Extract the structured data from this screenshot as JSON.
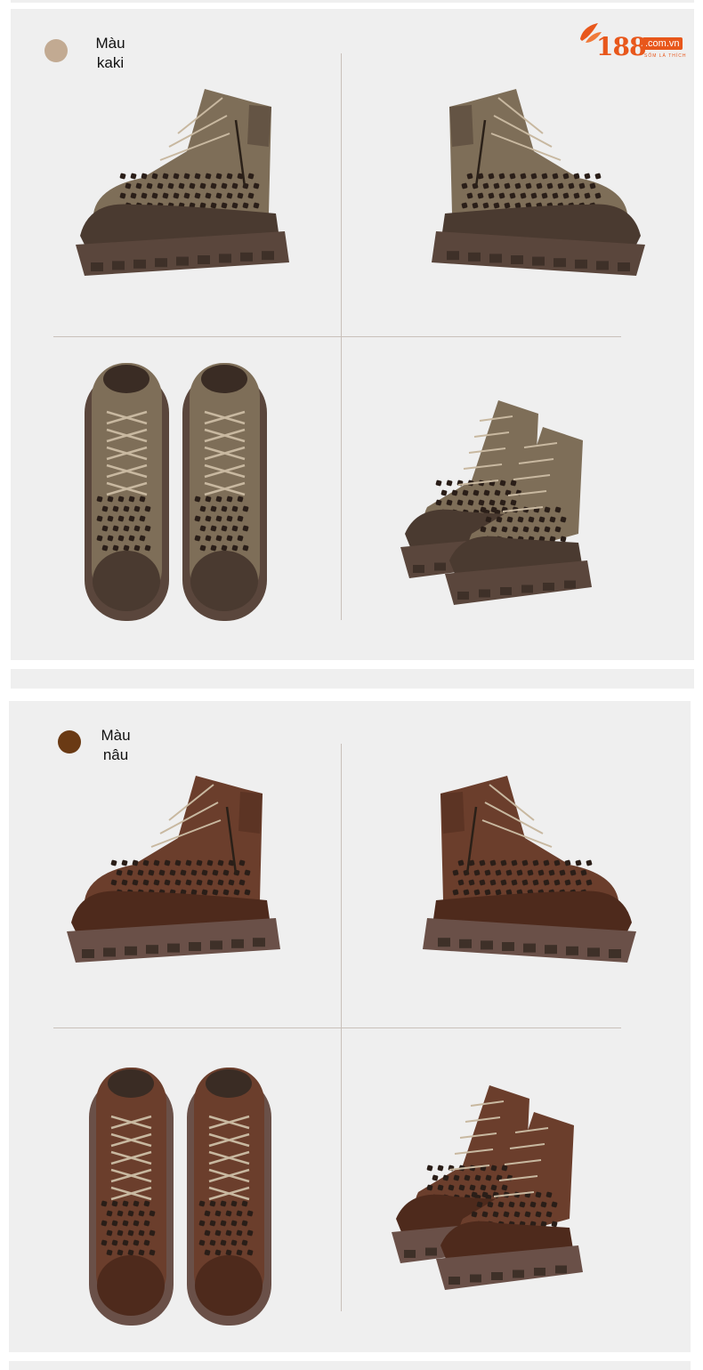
{
  "brand": {
    "logo_number": "188",
    "logo_domain": ".com.vn",
    "logo_slogan": "SỐM LÀ THÍCH",
    "color": "#e8571b"
  },
  "sections": [
    {
      "color_label": "Màu\nkaki",
      "swatch_color": "#c2aa92",
      "boot_upper": "#7e6e58",
      "boot_sole": "#5a463c",
      "boot_toe": "#4a3a30",
      "views": [
        "side-right",
        "side-left",
        "top-pair",
        "angle-pair"
      ]
    },
    {
      "color_label": "Màu\nnâu",
      "swatch_color": "#6a3a14",
      "boot_upper": "#6b3e2c",
      "boot_sole": "#6a5048",
      "boot_toe": "#4e2a1c",
      "views": [
        "side-right",
        "side-left",
        "top-pair",
        "angle-pair"
      ]
    }
  ]
}
